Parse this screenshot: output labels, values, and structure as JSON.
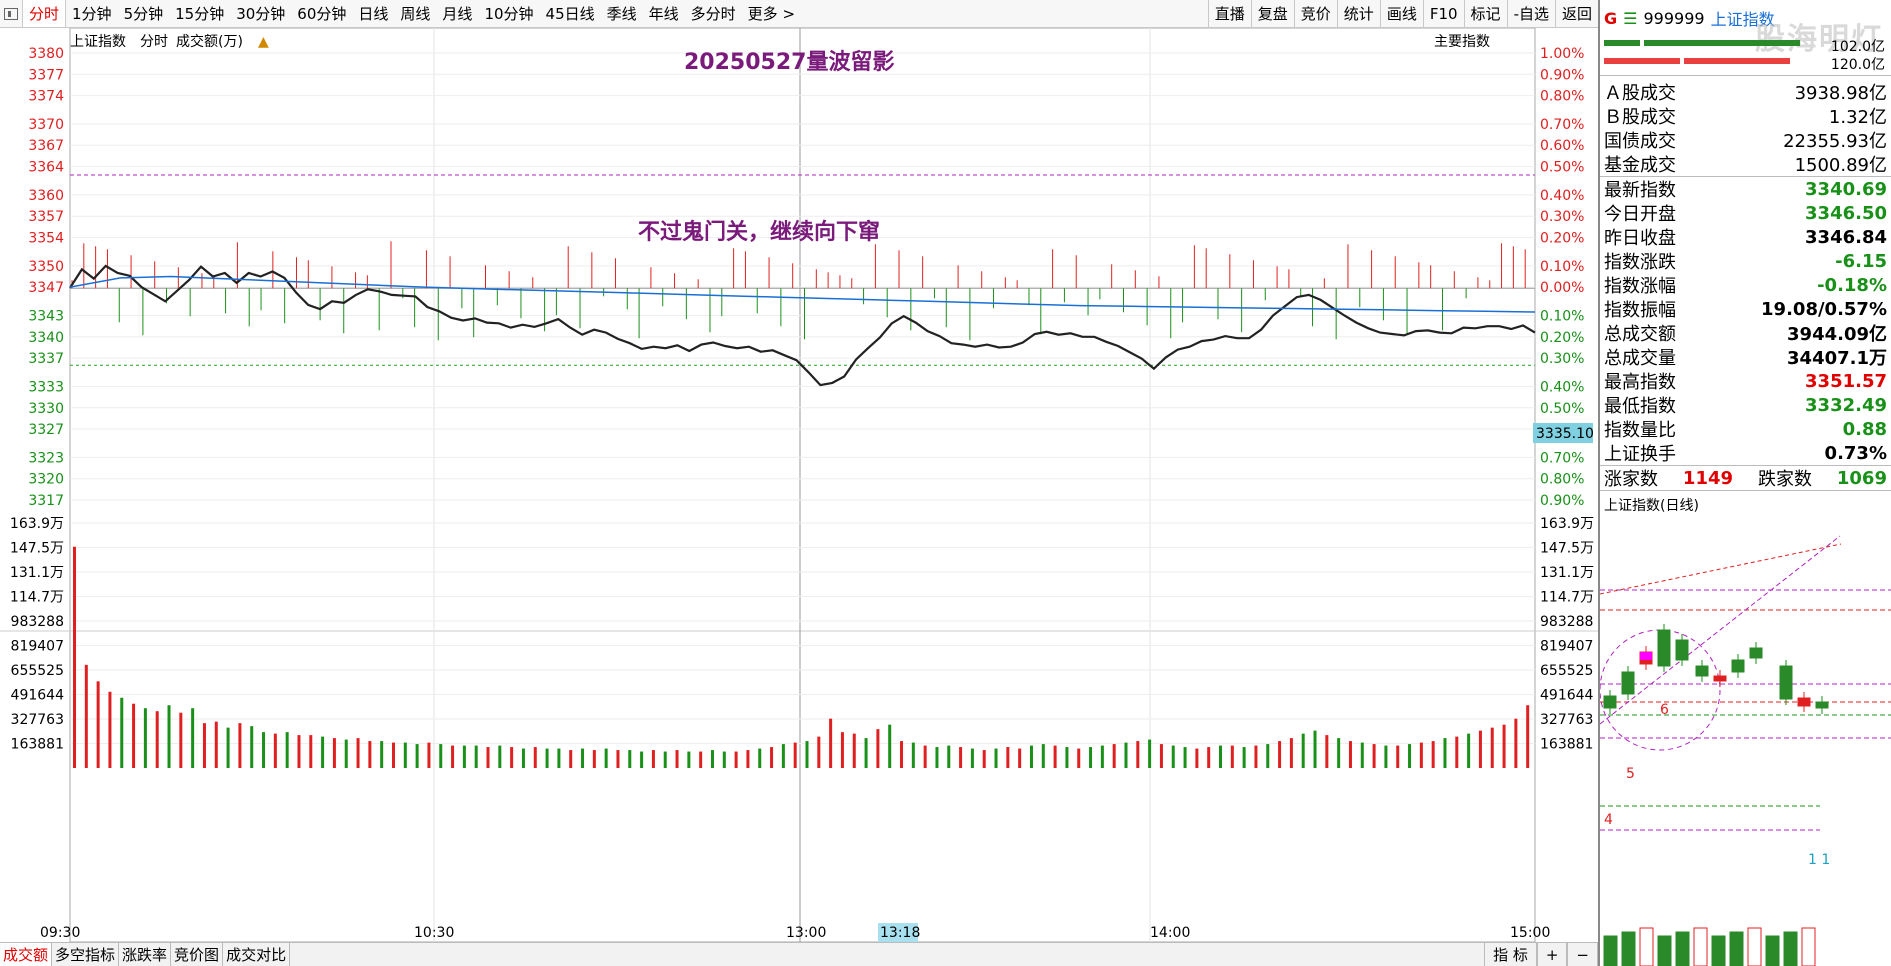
{
  "toolbar": {
    "tabs": [
      "分时",
      "1分钟",
      "5分钟",
      "15分钟",
      "30分钟",
      "60分钟",
      "日线",
      "周线",
      "月线",
      "10分钟",
      "45日线",
      "季线",
      "年线",
      "多分时",
      "更多 >"
    ],
    "right_buttons": [
      "直播",
      "复盘",
      "竞价",
      "统计",
      "画线",
      "F10",
      "标记",
      "-自选",
      "返回"
    ]
  },
  "header": {
    "index_name": "上证指数",
    "mode": "分时",
    "metric": "成交额(万)",
    "main_index_btn": "主要指数"
  },
  "annotations": {
    "title": "20250527量波留影",
    "note": "不过鬼门关，继续向下窜",
    "price_tag": "3335.10",
    "cursor_time": "13:18"
  },
  "chart_data": {
    "type": "line",
    "price_axis": {
      "left_ticks": [
        "3380",
        "3377",
        "3374",
        "3370",
        "3367",
        "3364",
        "3360",
        "3357",
        "3354",
        "3350",
        "3347",
        "3343",
        "3340",
        "3337",
        "3333",
        "3330",
        "3327",
        "3323",
        "3320",
        "3317"
      ],
      "right_ticks": [
        "1.00%",
        "0.90%",
        "0.80%",
        "0.70%",
        "0.60%",
        "0.50%",
        "0.40%",
        "0.30%",
        "0.20%",
        "0.10%",
        "0.00%",
        "0.10%",
        "0.20%",
        "0.30%",
        "0.40%",
        "0.50%",
        "0.60%",
        "0.70%",
        "0.80%",
        "0.90%"
      ],
      "prev_close": 3346.84,
      "range": [
        3317,
        3380
      ]
    },
    "volume_axis": {
      "ticks": [
        "163.9万",
        "147.5万",
        "131.1万",
        "114.7万",
        "983288",
        "819407",
        "655525",
        "491644",
        "327763",
        "163881"
      ]
    },
    "x_ticks": [
      "09:30",
      "10:30",
      "13:00",
      "14:00",
      "15:00"
    ],
    "series": [
      {
        "name": "上证指数",
        "color": "#222222",
        "values": [
          3346.9,
          3349.5,
          3348.2,
          3350.0,
          3349.0,
          3348.6,
          3347.0,
          3346.0,
          3345.0,
          3346.5,
          3348.0,
          3349.9,
          3348.5,
          3349.0,
          3347.6,
          3349.0,
          3348.5,
          3349.2,
          3348.3,
          3346.2,
          3344.5,
          3343.9,
          3345.0,
          3344.8,
          3345.9,
          3346.7,
          3346.4,
          3345.9,
          3345.8,
          3345.7,
          3344.2,
          3343.6,
          3342.7,
          3342.3,
          3342.6,
          3342.0,
          3341.9,
          3341.3,
          3341.7,
          3341.4,
          3341.9,
          3342.5,
          3341.3,
          3340.3,
          3341.0,
          3340.6,
          3339.7,
          3339.1,
          3338.3,
          3338.6,
          3338.4,
          3338.8,
          3338.0,
          3338.9,
          3339.2,
          3338.7,
          3338.4,
          3338.6,
          3337.9,
          3338.1,
          3337.4,
          3336.7,
          3335.0,
          3333.2,
          3333.5,
          3334.4,
          3336.8,
          3338.4,
          3339.9,
          3341.9,
          3342.9,
          3342.0,
          3340.8,
          3340.1,
          3339.1,
          3338.9,
          3338.6,
          3338.9,
          3338.5,
          3338.6,
          3339.2,
          3340.4,
          3340.7,
          3340.3,
          3340.5,
          3340.0,
          3340.0,
          3339.3,
          3338.7,
          3337.8,
          3336.9,
          3335.5,
          3337.1,
          3338.2,
          3338.6,
          3339.4,
          3339.6,
          3340.1,
          3339.8,
          3339.8,
          3341.0,
          3343.0,
          3344.3,
          3345.6,
          3345.9,
          3345.2,
          3344.1,
          3343.0,
          3342.0,
          3341.2,
          3340.6,
          3340.4,
          3340.2,
          3340.8,
          3340.9,
          3340.6,
          3340.5,
          3341.3,
          3341.2,
          3341.5,
          3341.5,
          3341.1,
          3341.6,
          3340.6
        ]
      },
      {
        "name": "均价",
        "color": "#1a6fd6",
        "values": [
          3347.0,
          3348.3,
          3348.5,
          3348.2,
          3347.9,
          3347.6,
          3347.3,
          3347.0,
          3346.8,
          3346.6,
          3346.4,
          3346.2,
          3346.0,
          3345.8,
          3345.6,
          3345.4,
          3345.2,
          3345.0,
          3344.8,
          3344.6,
          3344.4,
          3344.3,
          3344.2,
          3344.1,
          3344.0,
          3343.9,
          3343.8,
          3343.7,
          3343.6,
          3343.5
        ]
      }
    ],
    "volume_red": [
      true,
      true,
      true,
      true,
      false,
      true,
      false,
      true,
      false,
      true,
      false,
      true,
      true,
      false,
      true,
      false,
      false,
      true,
      false,
      true,
      true,
      false,
      true,
      false,
      true,
      true,
      false,
      true,
      false,
      false,
      true,
      false,
      true,
      false,
      false,
      true,
      false,
      true,
      false,
      true,
      false,
      false,
      true,
      false,
      true,
      false,
      true,
      false,
      false,
      true,
      false,
      true,
      false,
      true,
      false,
      false,
      true,
      true,
      false,
      true,
      false,
      true,
      false,
      true,
      true,
      true,
      true,
      false,
      true,
      false,
      true,
      false,
      true,
      false,
      false,
      true,
      false,
      true,
      false,
      true,
      true,
      false,
      false,
      true,
      false,
      true,
      false,
      false,
      true,
      false,
      true,
      false,
      true,
      false,
      false,
      true,
      true,
      false,
      true,
      false,
      true,
      false,
      true,
      true,
      false,
      false,
      true,
      false,
      true,
      false,
      true,
      false,
      true,
      false,
      true,
      true,
      false,
      true,
      false,
      true,
      true,
      true,
      true,
      true
    ],
    "volume_values": [
      1480000,
      690000,
      580000,
      510000,
      470000,
      430000,
      400000,
      380000,
      420000,
      370000,
      400000,
      300000,
      310000,
      270000,
      300000,
      280000,
      240000,
      230000,
      240000,
      220000,
      220000,
      210000,
      200000,
      190000,
      200000,
      180000,
      180000,
      170000,
      170000,
      160000,
      170000,
      160000,
      150000,
      150000,
      150000,
      140000,
      150000,
      140000,
      130000,
      140000,
      130000,
      130000,
      120000,
      130000,
      120000,
      130000,
      120000,
      120000,
      110000,
      120000,
      110000,
      120000,
      110000,
      110000,
      120000,
      110000,
      110000,
      120000,
      130000,
      140000,
      160000,
      170000,
      180000,
      210000,
      330000,
      240000,
      230000,
      200000,
      260000,
      290000,
      180000,
      170000,
      150000,
      140000,
      150000,
      140000,
      130000,
      120000,
      130000,
      140000,
      130000,
      150000,
      160000,
      150000,
      140000,
      130000,
      140000,
      150000,
      160000,
      170000,
      180000,
      190000,
      160000,
      150000,
      140000,
      130000,
      140000,
      150000,
      150000,
      140000,
      150000,
      160000,
      180000,
      200000,
      230000,
      250000,
      220000,
      200000,
      180000,
      170000,
      160000,
      150000,
      150000,
      160000,
      170000,
      180000,
      200000,
      210000,
      230000,
      250000,
      270000,
      290000,
      330000,
      420000
    ],
    "pct_ticks_up": [
      0.01,
      0.03,
      0.05,
      0.09,
      0.19,
      0.14,
      0.1,
      0.0,
      0.15,
      0.25,
      0.05,
      0.1,
      0.2,
      0.02
    ],
    "volume_range": [
      0,
      1639000
    ]
  },
  "side": {
    "header": {
      "g": "G",
      "code": "999999",
      "name": "上证指数",
      "watermark": "股海明灯"
    },
    "bar_labels": {
      "top": "102.0亿",
      "bottom": "120.0亿"
    },
    "turnover_rows": [
      {
        "label": "Ａ股成交",
        "value": "3938.98亿"
      },
      {
        "label": "Ｂ股成交",
        "value": "1.32亿"
      },
      {
        "label": "国债成交",
        "value": "22355.93亿"
      },
      {
        "label": "基金成交",
        "value": "1500.89亿"
      }
    ],
    "quote_rows": [
      {
        "label": "最新指数",
        "value": "3340.69",
        "color": "green"
      },
      {
        "label": "今日开盘",
        "value": "3346.50",
        "color": "green"
      },
      {
        "label": "昨日收盘",
        "value": "3346.84",
        "color": "black"
      },
      {
        "label": "指数涨跌",
        "value": "-6.15",
        "color": "green"
      },
      {
        "label": "指数涨幅",
        "value": "-0.18%",
        "color": "green"
      },
      {
        "label": "指数振幅",
        "value": "19.08/0.57%",
        "color": "black"
      },
      {
        "label": "总成交额",
        "value": "3944.09亿",
        "color": "black"
      },
      {
        "label": "总成交量",
        "value": "34407.1万",
        "color": "black"
      },
      {
        "label": "最高指数",
        "value": "3351.57",
        "color": "red"
      },
      {
        "label": "最低指数",
        "value": "3332.49",
        "color": "green"
      },
      {
        "label": "指数量比",
        "value": "0.88",
        "color": "green"
      },
      {
        "label": "上证换手",
        "value": "0.73%",
        "color": "black"
      }
    ],
    "breadth": {
      "up_label": "涨家数",
      "up": "1149",
      "down_label": "跌家数",
      "down": "1069"
    },
    "mini_title": "上证指数(日线)",
    "mini_labels": [
      "6",
      "5",
      "4",
      "1  1"
    ]
  },
  "bottom_tabs": {
    "left": [
      "成交额",
      "多空指标",
      "涨跌率",
      "竞价图",
      "成交对比"
    ],
    "right": [
      "指 标",
      "+",
      "−"
    ]
  }
}
